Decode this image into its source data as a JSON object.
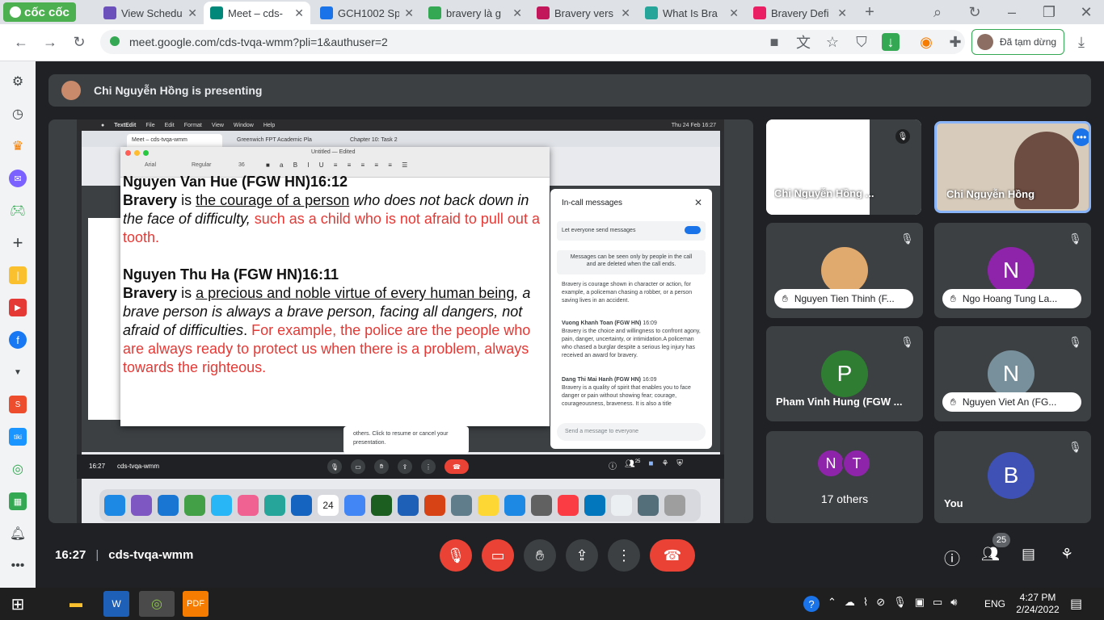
{
  "browser": {
    "logo_text": "cốc cốc",
    "tabs": [
      {
        "label": "View Schedu",
        "color": "#6b4fbb",
        "active": false
      },
      {
        "label": "Meet – cds-",
        "color": "#00897b",
        "active": true
      },
      {
        "label": "GCH1002 Sp",
        "color": "#1a73e8",
        "active": false
      },
      {
        "label": "bravery là g",
        "color": "#34a853",
        "active": false
      },
      {
        "label": "Bravery vers",
        "color": "#c2185b",
        "active": false
      },
      {
        "label": "What Is Bra",
        "color": "#26a69a",
        "active": false
      },
      {
        "label": "Bravery Defi",
        "color": "#e91e63",
        "active": false
      }
    ],
    "url": "meet.google.com/cds-tvqa-wmm?pli=1&authuser=2",
    "paused_label": "Đã tạm dừng"
  },
  "presenting_banner": "Chi Nguyễn Hồng is presenting",
  "shared_screen": {
    "mac_menu": [
      "TextEdit",
      "File",
      "Edit",
      "Format",
      "View",
      "Window",
      "Help"
    ],
    "mac_clock": "Thu 24 Feb  16:27",
    "inner_tabs": [
      "Meet – cds-tvqa-wmm",
      "Greenwich FPT Academic Pla",
      "Chapter 10: Task 2"
    ],
    "doc_title": "Untitled — Edited",
    "doc_font": "Arial",
    "doc_style": "Regular",
    "doc_size": "36",
    "entries": [
      {
        "author": "Nguyen Van Hue (FGW HN)16:12",
        "word": "Bravery",
        "is": " is ",
        "underlined": "the courage of a person",
        "italic": " who does not back down in the face of difficulty,",
        "red": " such as a child who is not afraid to pull out a tooth."
      },
      {
        "author": "Nguyen Thu Ha (FGW HN)16:11",
        "word": "Bravery",
        "is": " is ",
        "underlined": "a precious and noble virtue of every human being",
        "italic": ", a brave person is always a brave person, facing all dangers, not afraid of difficulties",
        "dot": ". ",
        "red": "For example, the police are the people who are always ready to protect us when there is a problem, always towards the righteous."
      }
    ],
    "chat": {
      "title": "In-call messages",
      "toggle_label": "Let everyone send messages",
      "notice": "Messages can be seen only by people in the call and are deleted when the call ends.",
      "messages": [
        {
          "sender": "",
          "time": "",
          "text": "Bravery is courage shown in character or action, for example, a policeman chasing a robber, or a person saving lives in an accident."
        },
        {
          "sender": "Vuong Khanh Toan (FGW HN)",
          "time": "16:09",
          "text": "Bravery is the choice and willingness to confront agony, pain, danger, uncertainty, or intimidation.A policeman who chased a burglar despite a serious leg injury has received an award for bravery."
        },
        {
          "sender": "Dang Thi Mai Hanh (FGW HN)",
          "time": "16:09",
          "text": "Bravery is a quality of spirit that enables you to face danger or pain without showing fear; courage, courageousness, braveness. It is also a title"
        }
      ],
      "placeholder": "Send a message to everyone"
    },
    "popup_text": "others. Click to resume or cancel your presentation.",
    "inner_time": "16:27",
    "inner_code": "cds-tvqa-wmm",
    "inner_people_count": "25",
    "dock_date": "24"
  },
  "participants": {
    "presenter_thumb_label": "Chi Nguyễn Hồng ...",
    "presenter_name": "Chi Nguyễn Hồng",
    "tiles": [
      {
        "name": "Nguyen Tien Thinh (F...",
        "initial": "",
        "color": "#e0a96d",
        "has_photo": true
      },
      {
        "name": "Ngo Hoang Tung La...",
        "initial": "N",
        "color": "#8e24aa"
      },
      {
        "name": "Pham Vinh Hung (FGW ...",
        "initial": "P",
        "color": "#2e7d32"
      },
      {
        "name": "Nguyen Viet An (FG...",
        "initial": "N",
        "color": "#78909c"
      }
    ],
    "others": {
      "label": "17 others",
      "initials": [
        "N",
        "T"
      ],
      "colors": [
        "#8e24aa",
        "#8e24aa"
      ]
    },
    "you": {
      "label": "You",
      "initial": "B",
      "color": "#3f51b5"
    }
  },
  "bottom": {
    "time": "16:27",
    "meeting_code": "cds-tvqa-wmm",
    "people_count": "25"
  },
  "taskbar": {
    "language": "ENG",
    "time": "4:27 PM",
    "date": "2/24/2022"
  }
}
